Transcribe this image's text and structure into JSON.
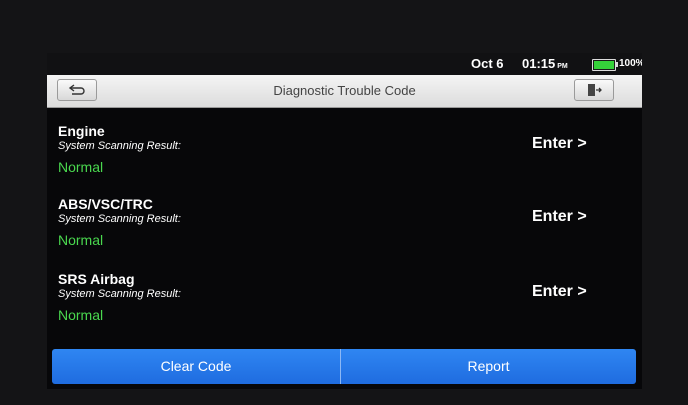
{
  "status_bar": {
    "date": "Oct 6",
    "time": "01:15",
    "ampm": "PM",
    "battery_percent": "100%",
    "battery_level": 1.0,
    "battery_color": "#35d23a"
  },
  "title_bar": {
    "title": "Diagnostic Trouble Code",
    "back_icon": "back-arrow-icon",
    "exit_icon": "exit-icon"
  },
  "systems": [
    {
      "name": "Engine",
      "subtitle": "System Scanning Result:",
      "status": "Normal",
      "action": "Enter >"
    },
    {
      "name": "ABS/VSC/TRC",
      "subtitle": "System Scanning Result:",
      "status": "Normal",
      "action": "Enter >"
    },
    {
      "name": "SRS Airbag",
      "subtitle": "System Scanning Result:",
      "status": "Normal",
      "action": "Enter >"
    }
  ],
  "bottom_bar": {
    "clear_label": "Clear Code",
    "report_label": "Report"
  },
  "colors": {
    "status_normal": "#4ad84f",
    "button_blue": "#2f86f2"
  }
}
